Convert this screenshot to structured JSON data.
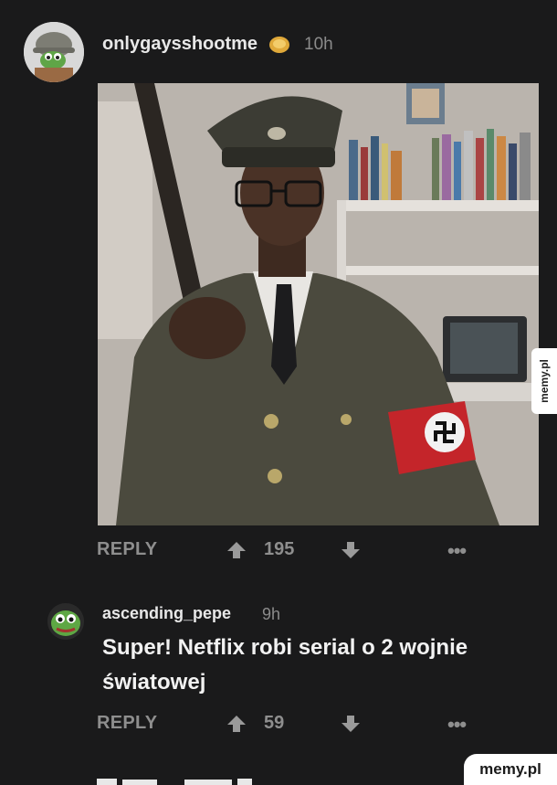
{
  "post": {
    "username": "onlygaysshootme",
    "award_icon": "gold-coin-icon",
    "time": "10h",
    "score": "195",
    "reply_label": "REPLY",
    "more_label": "•••"
  },
  "reply_comment": {
    "username": "ascending_pepe",
    "time": "9h",
    "text": "Super! Netflix robi serial o 2 wojnie światowej",
    "score": "59",
    "reply_label": "REPLY",
    "more_label": "•••"
  },
  "watermarks": {
    "side": "memy.pl",
    "bottom": "memy.pl"
  },
  "colors": {
    "background": "#1a1a1b",
    "action_gray": "#8e8e8e",
    "armband_red": "#c4252a",
    "uniform_green": "#4b4a3e"
  }
}
